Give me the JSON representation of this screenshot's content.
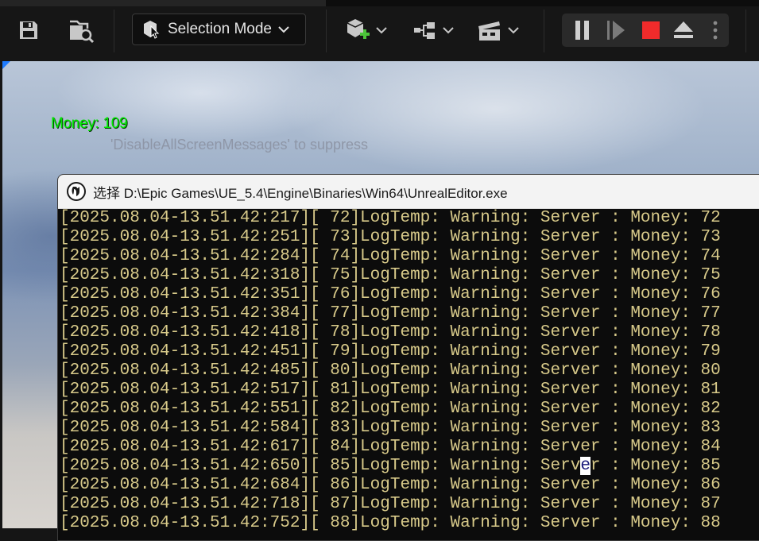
{
  "toolbar": {
    "mode_label": "Selection Mode",
    "icons": [
      "save-icon",
      "browse-icon",
      "mode-icon",
      "add-actor-icon",
      "blueprint-icon",
      "cinematics-icon",
      "pause-icon",
      "frame-skip-icon",
      "stop-icon",
      "eject-icon",
      "more-icon"
    ],
    "colors": {
      "stop": "#f02b2b",
      "add_plus": "#4cc43a"
    }
  },
  "viewport": {
    "money_text": "Money: 109",
    "suppress_text": "'DisableAllScreenMessages' to suppress"
  },
  "console": {
    "title": "选择 D:\\Epic Games\\UE_5.4\\Engine\\Binaries\\Win64\\UnrealEditor.exe",
    "lines": [
      {
        "pre": "[2025.08.04-13.51.42:217][ 72]LogTemp: Warning: Server : Money: 72"
      },
      {
        "pre": "[2025.08.04-13.51.42:251][ 73]LogTemp: Warning: Server : Money: 73"
      },
      {
        "pre": "[2025.08.04-13.51.42:284][ 74]LogTemp: Warning: Server : Money: 74"
      },
      {
        "pre": "[2025.08.04-13.51.42:318][ 75]LogTemp: Warning: Server : Money: 75"
      },
      {
        "pre": "[2025.08.04-13.51.42:351][ 76]LogTemp: Warning: Server : Money: 76"
      },
      {
        "pre": "[2025.08.04-13.51.42:384][ 77]LogTemp: Warning: Server : Money: 77"
      },
      {
        "pre": "[2025.08.04-13.51.42:418][ 78]LogTemp: Warning: Server : Money: 78"
      },
      {
        "pre": "[2025.08.04-13.51.42:451][ 79]LogTemp: Warning: Server : Money: 79"
      },
      {
        "pre": "[2025.08.04-13.51.42:485][ 80]LogTemp: Warning: Server : Money: 80"
      },
      {
        "pre": "[2025.08.04-13.51.42:517][ 81]LogTemp: Warning: Server : Money: 81"
      },
      {
        "pre": "[2025.08.04-13.51.42:551][ 82]LogTemp: Warning: Server : Money: 82"
      },
      {
        "pre": "[2025.08.04-13.51.42:584][ 83]LogTemp: Warning: Server : Money: 83"
      },
      {
        "pre": "[2025.08.04-13.51.42:617][ 84]LogTemp: Warning: Server : Money: 84"
      },
      {
        "pre": "[2025.08.04-13.51.42:650][ 85]LogTemp: Warning: Serv",
        "sel": "e",
        "post": "r : Money: 85"
      },
      {
        "pre": "[2025.08.04-13.51.42:684][ 86]LogTemp: Warning: Server : Money: 86"
      },
      {
        "pre": "[2025.08.04-13.51.42:718][ 87]LogTemp: Warning: Server : Money: 87"
      },
      {
        "pre": "[2025.08.04-13.51.42:752][ 88]LogTemp: Warning: Server : Money: 88"
      }
    ]
  }
}
